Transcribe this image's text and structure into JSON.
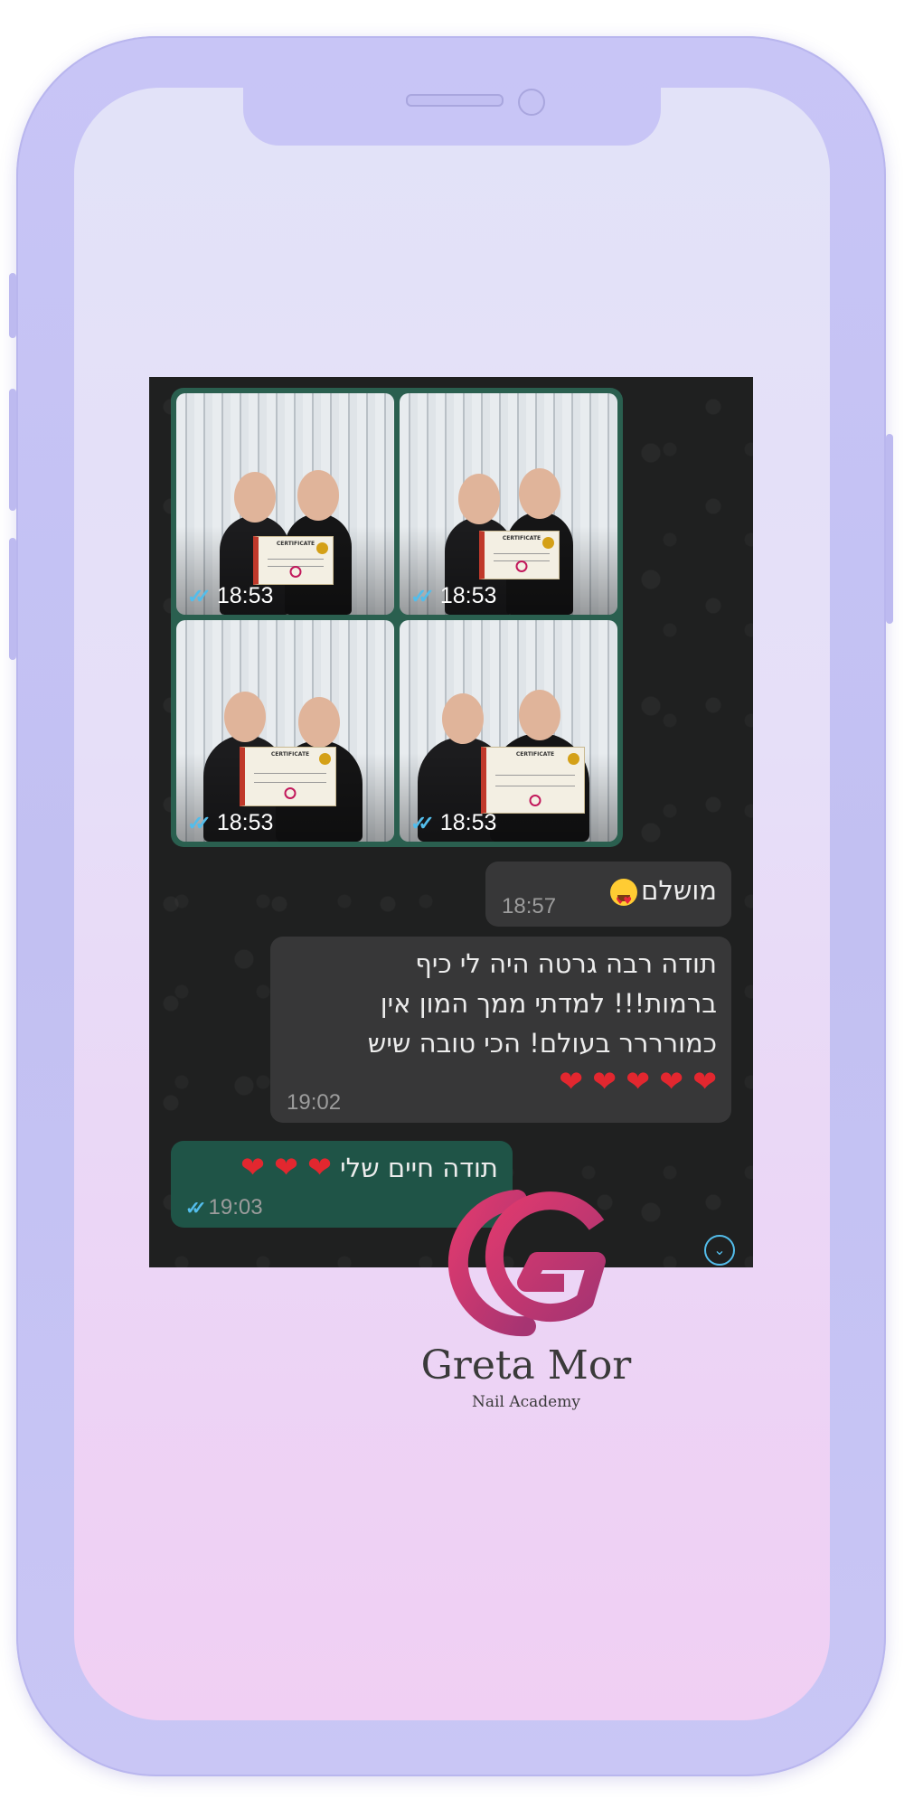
{
  "photos": [
    {
      "time": "18:53"
    },
    {
      "time": "18:53"
    },
    {
      "time": "18:53"
    },
    {
      "time": "18:53"
    }
  ],
  "certificate_title": "CERTIFICATE",
  "messages": {
    "incoming_1": {
      "text": "מושלם",
      "time": "18:57"
    },
    "incoming_2": {
      "lines": [
        "תודה רבה גרטה היה לי כיף",
        "ברמות!!! למדתי ממך המון אין",
        "כמורררר בעולם! הכי טובה שיש"
      ],
      "hearts": "❤ ❤ ❤ ❤ ❤",
      "time": "19:02"
    },
    "outgoing": {
      "text": "תודה חיים שלי",
      "hearts": "❤ ❤ ❤",
      "time": "19:03"
    }
  },
  "brand": {
    "name": "Greta Mor",
    "subtitle": "Nail Academy"
  },
  "colors": {
    "frame": "#c8c5f6",
    "chat_bg": "#1f2020",
    "outgoing_bubble": "#1f5447",
    "incoming_bubble": "#373738",
    "read_ticks": "#53bdeb",
    "logo_pink": "#d6336c"
  },
  "icons": {
    "read_receipt": "double-check-icon",
    "scroll_down": "chevron-down-icon"
  }
}
